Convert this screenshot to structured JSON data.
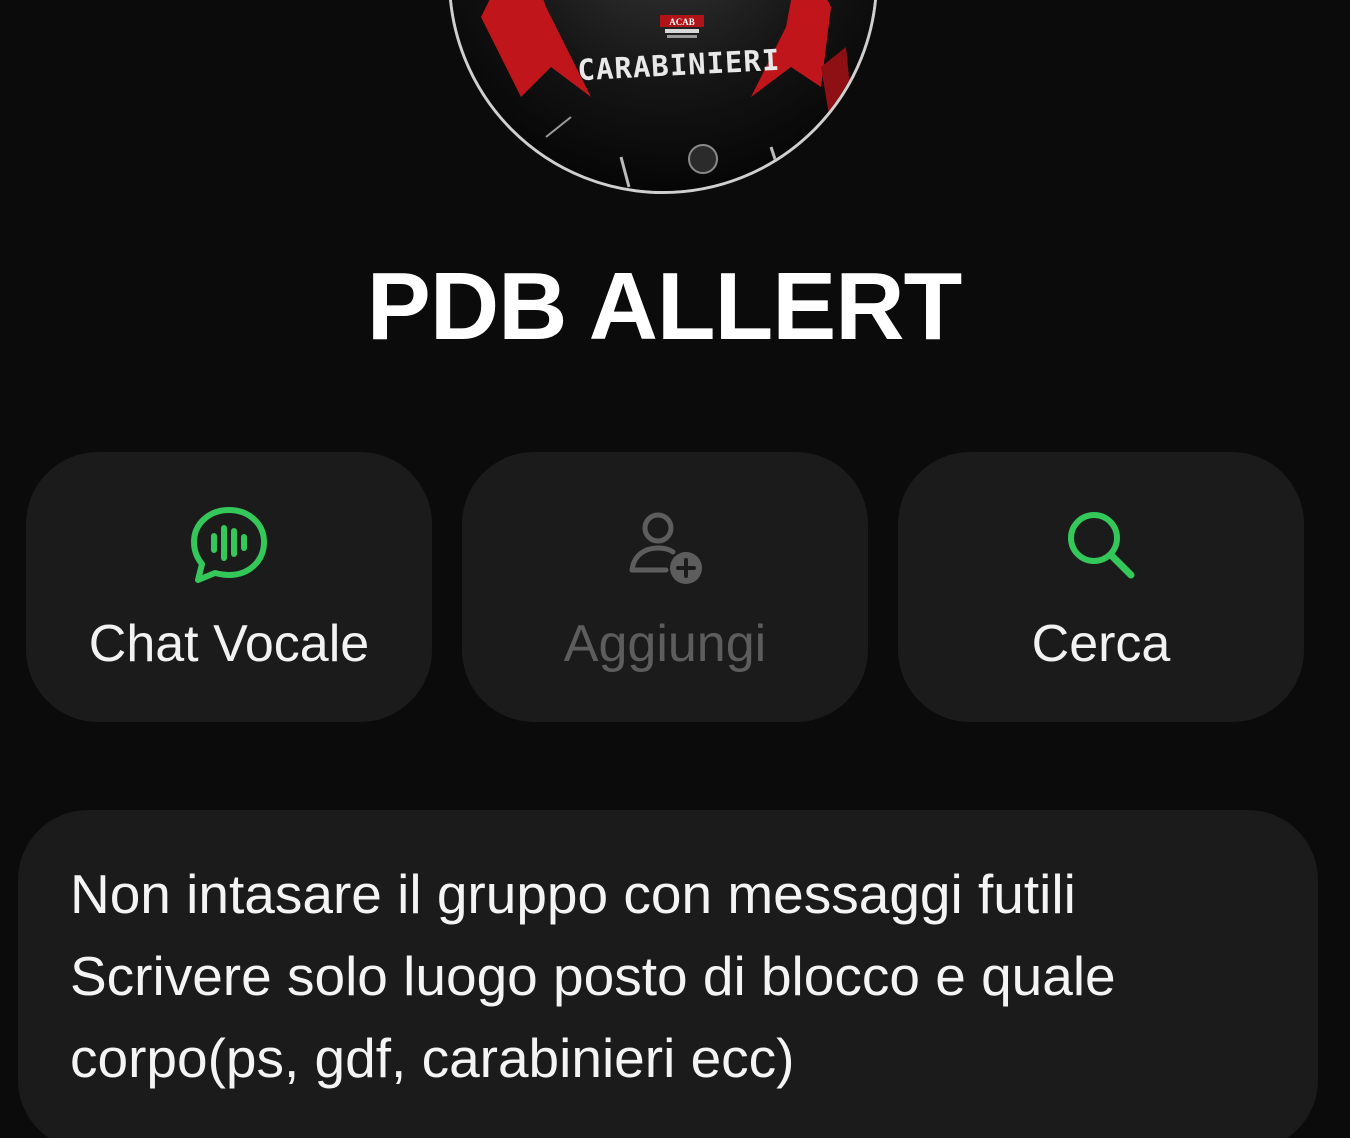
{
  "avatar": {
    "helmet_text": "CARABINIERI",
    "badge_text": "ACAB",
    "accent_color": "#c0161b"
  },
  "group": {
    "title": "PDB ALLERT"
  },
  "actions": [
    {
      "label": "Chat Vocale",
      "icon": "voice-chat-icon",
      "color": "#34c759",
      "enabled": true
    },
    {
      "label": "Aggiungi",
      "icon": "add-person-icon",
      "color": "#5d5d5d",
      "enabled": false
    },
    {
      "label": "Cerca",
      "icon": "search-icon",
      "color": "#34c759",
      "enabled": true
    }
  ],
  "description": {
    "lines": [
      "Non intasare il gruppo con messaggi futili",
      "Scrivere solo luogo posto di blocco e quale",
      "corpo(ps, gdf, carabinieri ecc)"
    ]
  }
}
